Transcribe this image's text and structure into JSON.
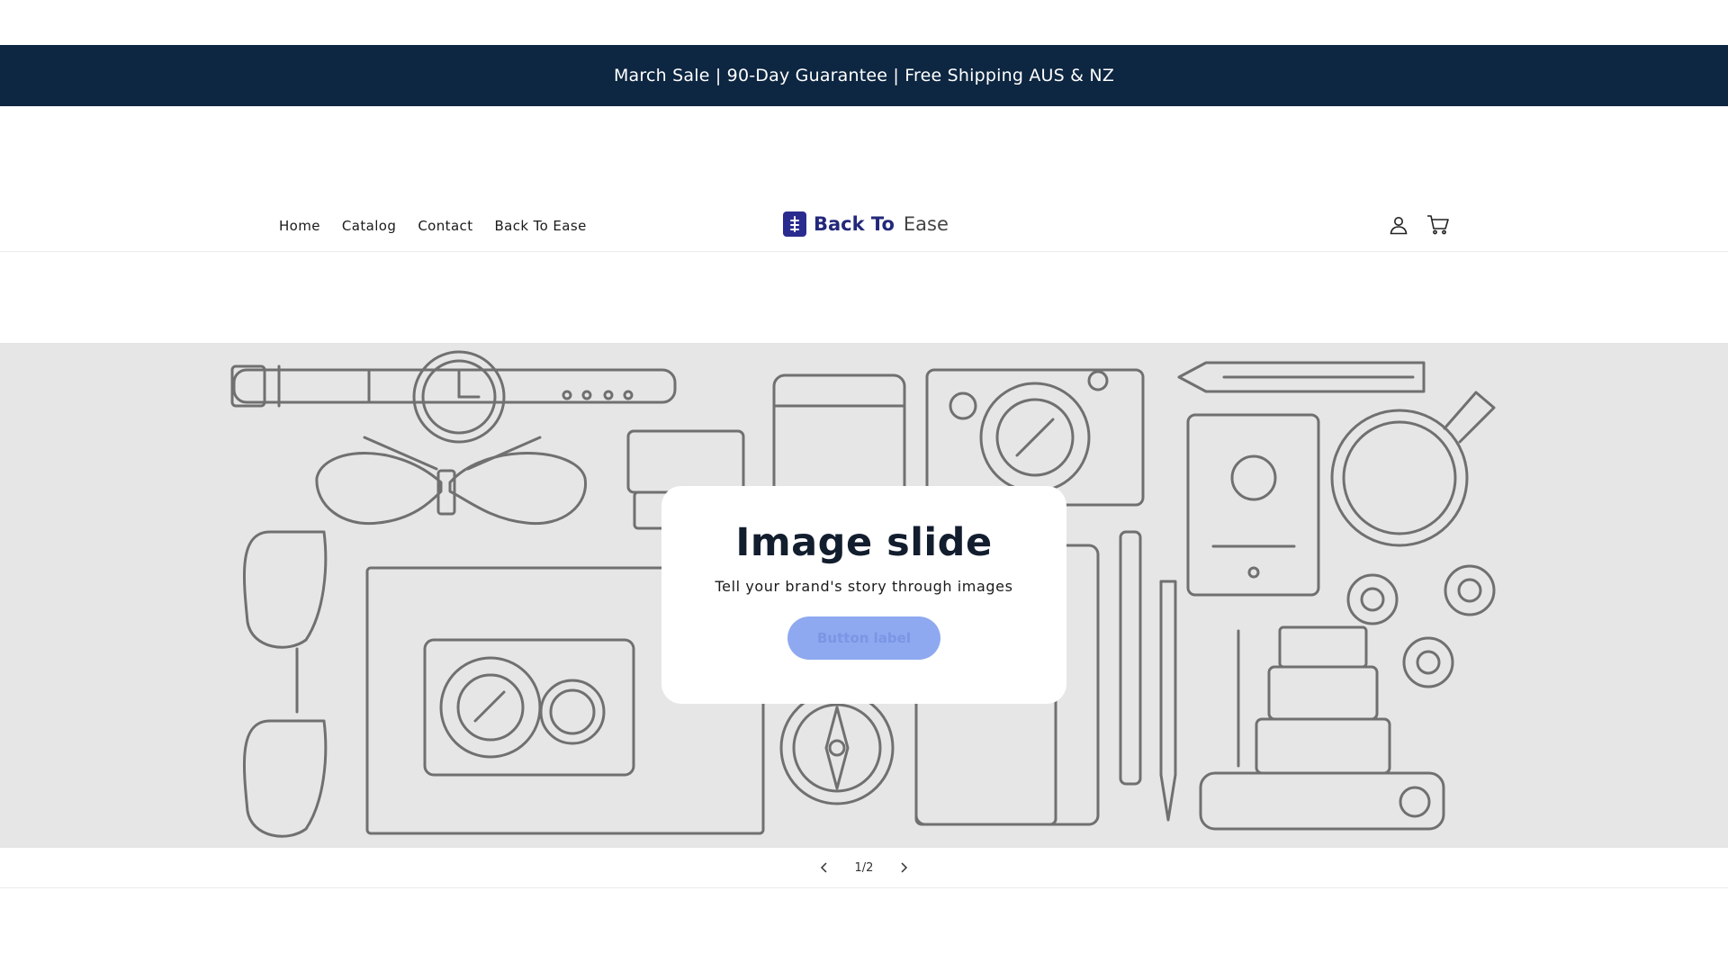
{
  "announcement": {
    "text": "March Sale | 90-Day Guarantee | Free Shipping AUS & NZ"
  },
  "nav": {
    "items": [
      {
        "label": "Home"
      },
      {
        "label": "Catalog"
      },
      {
        "label": "Contact"
      },
      {
        "label": "Back To Ease"
      }
    ]
  },
  "logo": {
    "strong": "Back To",
    "light": "Ease"
  },
  "header_icons": {
    "account": "account-icon",
    "cart": "cart-icon"
  },
  "slide": {
    "title": "Image slide",
    "subtitle": "Tell your brand's story through images",
    "button_label": "Button label"
  },
  "slider": {
    "counter": "1/2",
    "prev_icon": "chevron-left-icon",
    "next_icon": "chevron-right-icon"
  },
  "colors": {
    "announcement_bg": "#0d2641",
    "button_bg": "#8ea9f0",
    "slide_bg": "#e6e6e6",
    "logo_brand": "#23287a"
  }
}
